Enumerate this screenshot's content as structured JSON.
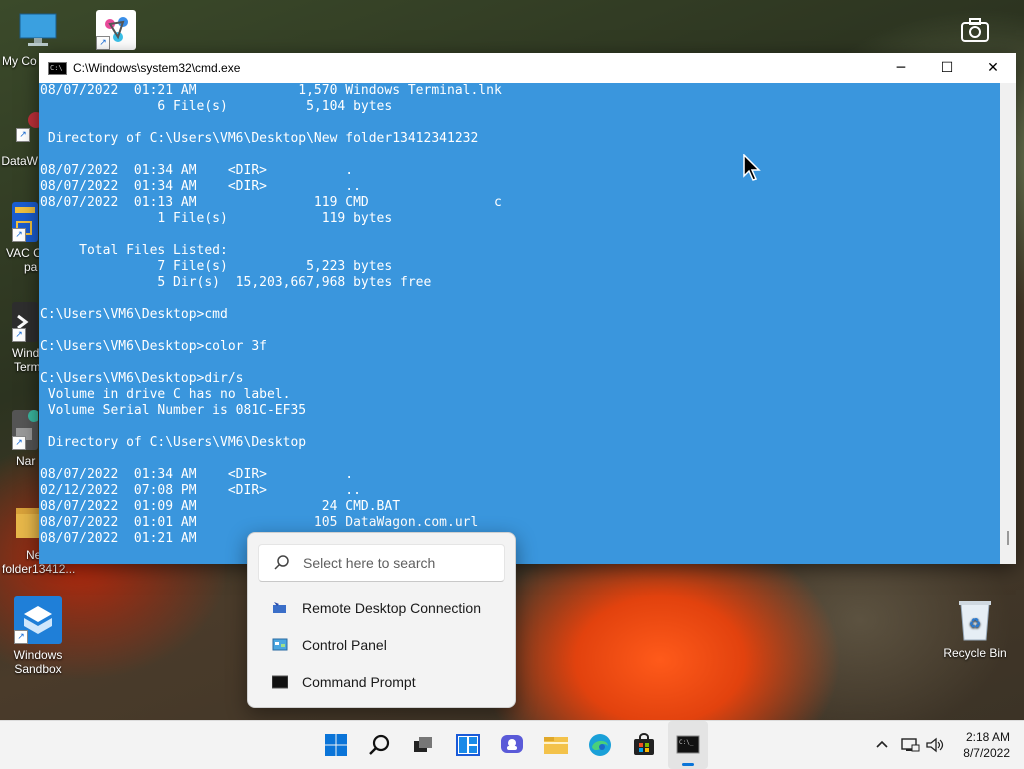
{
  "desktop": {
    "icons": [
      {
        "label": "My Co"
      },
      {
        "label": ""
      },
      {
        "label": "DataW"
      },
      {
        "label": "VAC C"
      },
      {
        "label": "pa"
      },
      {
        "label": "Wind"
      },
      {
        "label": "Term"
      },
      {
        "label": "Nar"
      },
      {
        "label": "Ne"
      },
      {
        "label": "folder13412..."
      },
      {
        "label": "Windows"
      },
      {
        "label": "Sandbox"
      },
      {
        "label": "Recycle Bin"
      }
    ]
  },
  "cmd_window": {
    "title": "C:\\Windows\\system32\\cmd.exe",
    "buttons": {
      "minimize": "─",
      "maximize": "☐",
      "close": "✕"
    },
    "console_lines": [
      "08/07/2022  01:21 AM             1,570 Windows Terminal.lnk",
      "               6 File(s)          5,104 bytes",
      "",
      " Directory of C:\\Users\\VM6\\Desktop\\New folder13412341232",
      "",
      "08/07/2022  01:34 AM    <DIR>          .",
      "08/07/2022  01:34 AM    <DIR>          ..",
      "08/07/2022  01:13 AM               119 CMD                c",
      "               1 File(s)            119 bytes",
      "",
      "     Total Files Listed:",
      "               7 File(s)          5,223 bytes",
      "               5 Dir(s)  15,203,667,968 bytes free",
      "",
      "C:\\Users\\VM6\\Desktop>cmd",
      "",
      "C:\\Users\\VM6\\Desktop>color 3f",
      "",
      "C:\\Users\\VM6\\Desktop>dir/s",
      " Volume in drive C has no label.",
      " Volume Serial Number is 081C-EF35",
      "",
      " Directory of C:\\Users\\VM6\\Desktop",
      "",
      "08/07/2022  01:34 AM    <DIR>          .",
      "02/12/2022  07:08 PM    <DIR>          ..",
      "08/07/2022  01:09 AM                24 CMD.BAT",
      "08/07/2022  01:01 AM               105 DataWagon.com.url",
      "08/07/2022  01:21 AM"
    ],
    "console_color": "#3a96dd"
  },
  "search_popup": {
    "placeholder": "Select here to search",
    "results": [
      {
        "label": "Remote Desktop Connection",
        "icon": "remote-desktop-icon"
      },
      {
        "label": "Control Panel",
        "icon": "control-panel-icon"
      },
      {
        "label": "Command Prompt",
        "icon": "command-prompt-icon"
      }
    ]
  },
  "taskbar": {
    "apps": [
      "start",
      "search",
      "task-view",
      "widgets",
      "chat",
      "file-explorer",
      "edge",
      "store",
      "terminal"
    ],
    "clock": {
      "time": "2:18 AM",
      "date": "8/7/2022"
    }
  }
}
